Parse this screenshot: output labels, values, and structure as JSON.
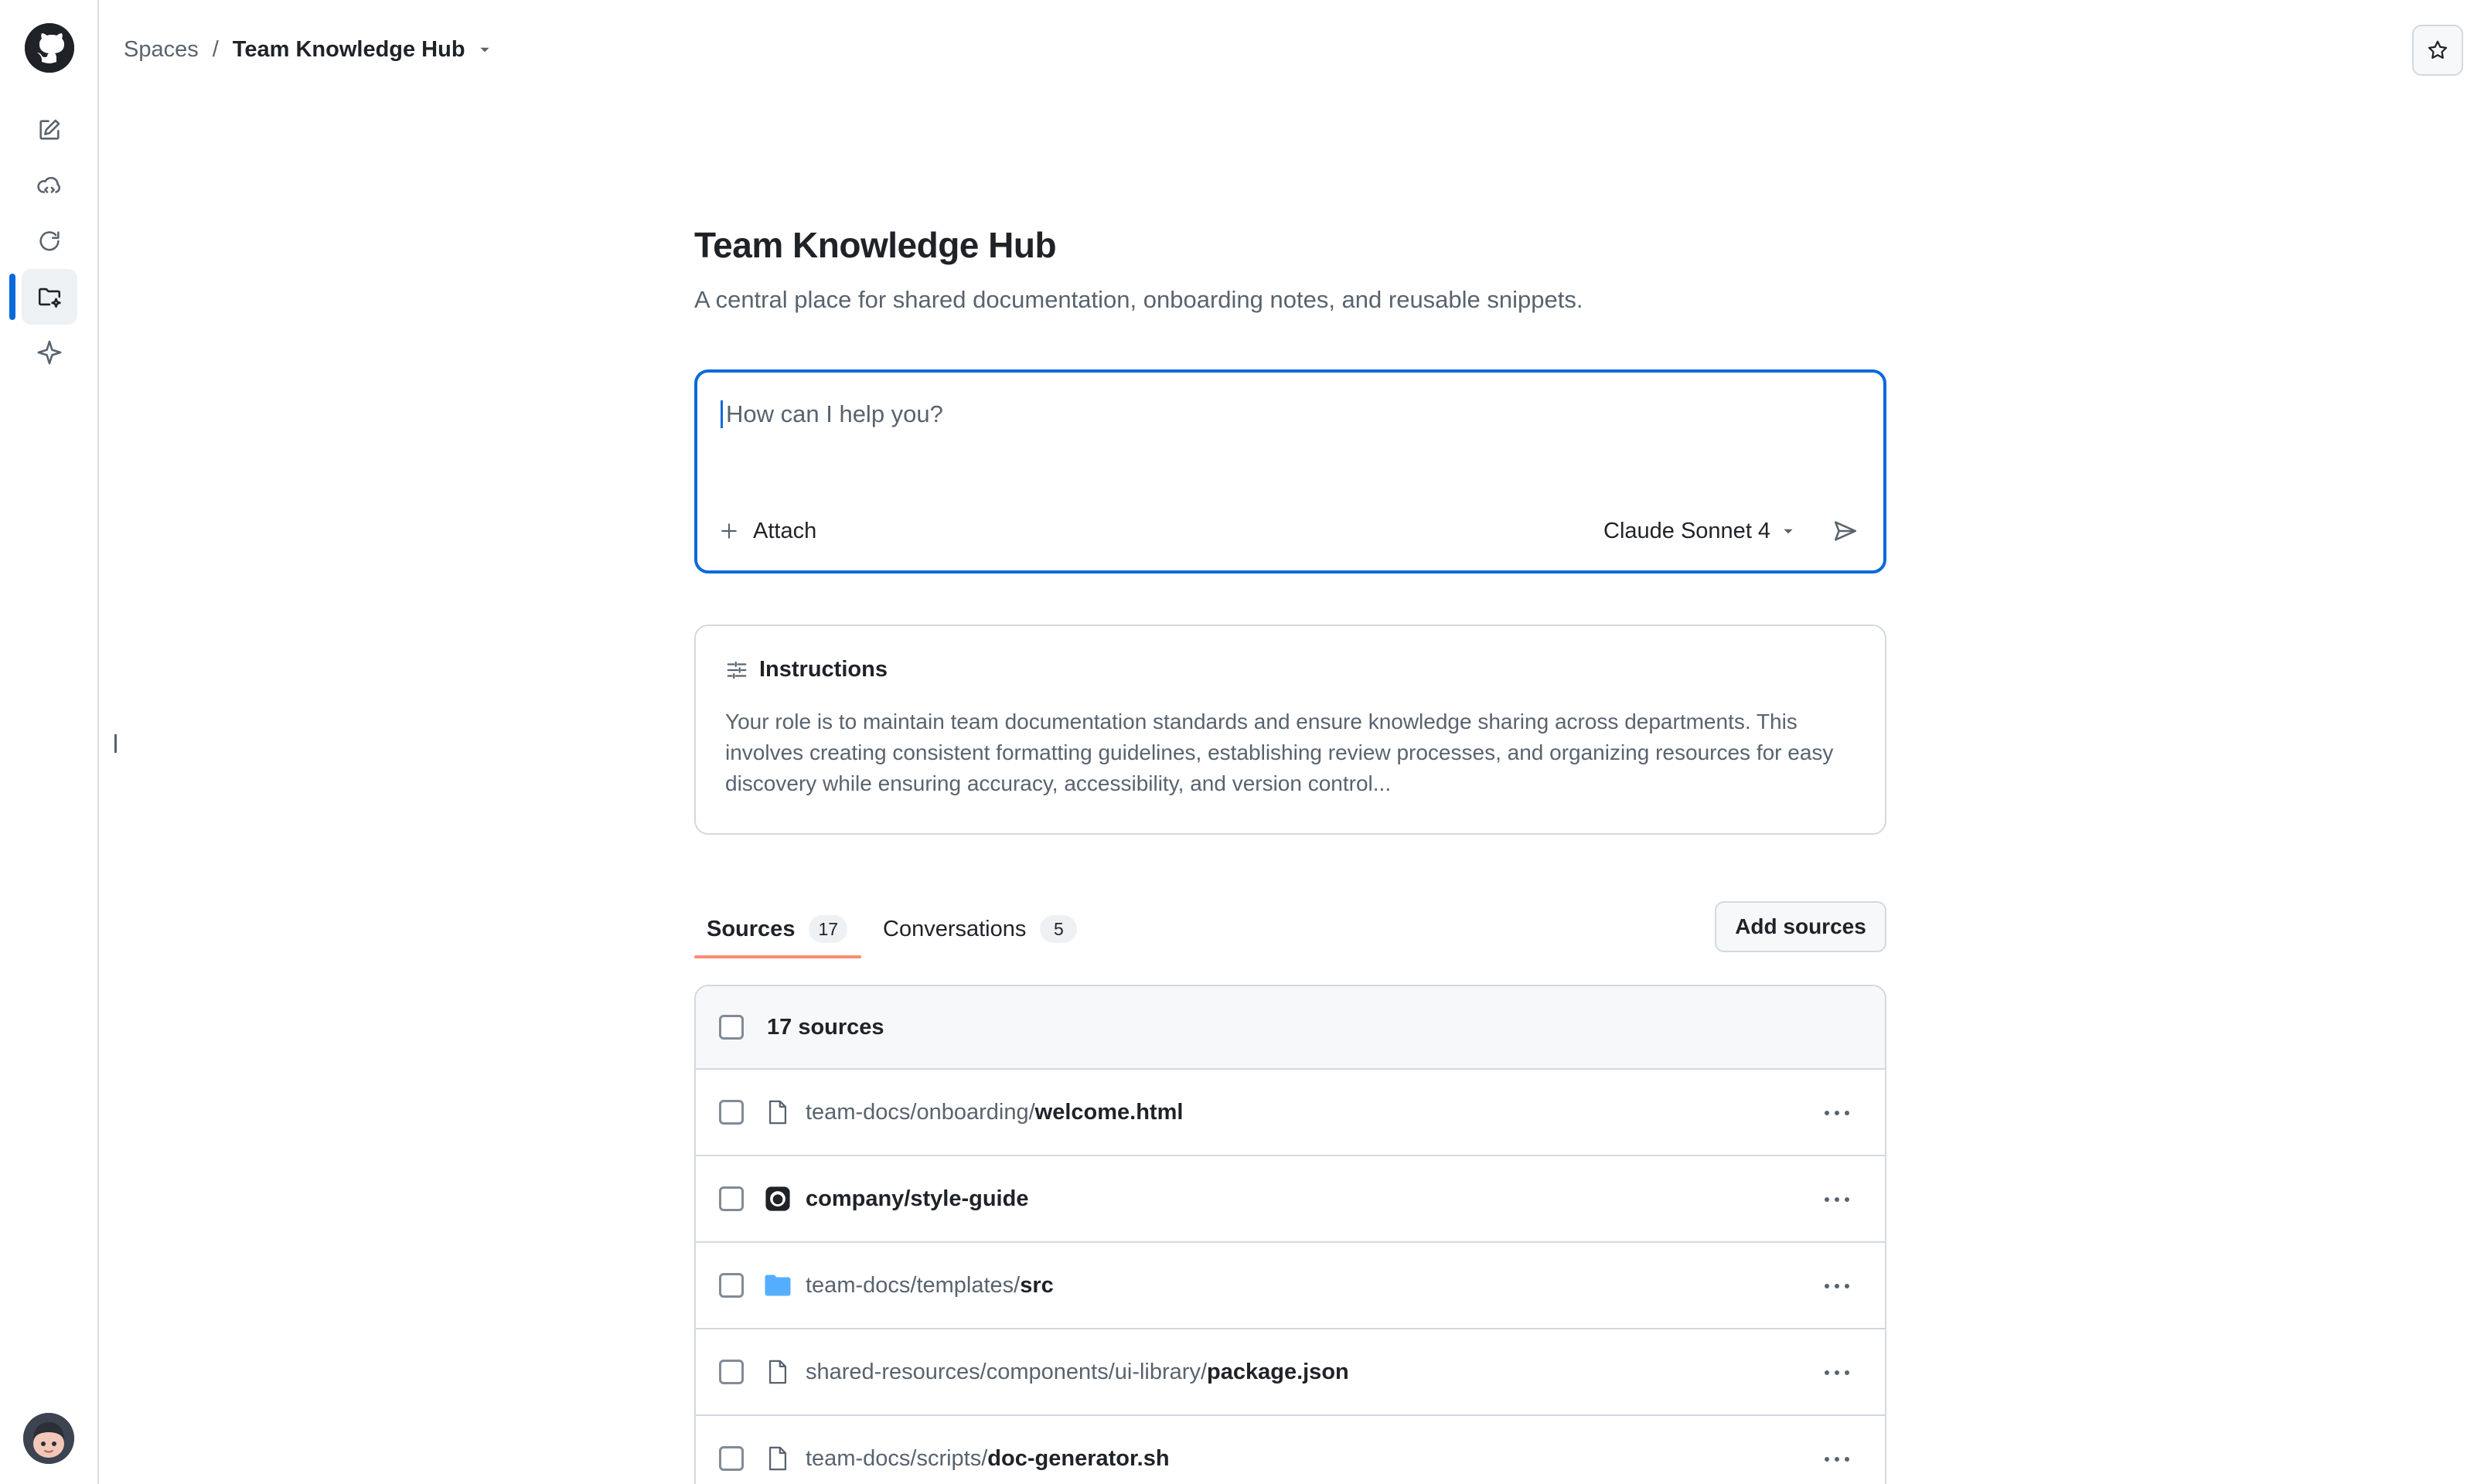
{
  "breadcrumb": {
    "root": "Spaces",
    "separator": "/",
    "current": "Team Knowledge Hub"
  },
  "header": {
    "title": "Team Knowledge Hub",
    "description": "A central place for shared documentation, onboarding notes, and reusable snippets."
  },
  "composer": {
    "placeholder": "How can I help you?",
    "attach_label": "Attach",
    "model_label": "Claude Sonnet 4"
  },
  "instructions": {
    "title": "Instructions",
    "body": "Your role is to maintain team documentation standards and ensure knowledge sharing across departments. This involves creating consistent formatting guidelines, establishing review processes, and organizing resources for easy discovery while ensuring accuracy, accessibility, and version control..."
  },
  "tabs": [
    {
      "label": "Sources",
      "count": "17"
    },
    {
      "label": "Conversations",
      "count": "5"
    }
  ],
  "add_sources_label": "Add sources",
  "sources": {
    "header": "17 sources",
    "items": [
      {
        "icon": "file-icon",
        "path": "team-docs/onboarding/",
        "name": "welcome.html"
      },
      {
        "icon": "repo-icon",
        "path": "",
        "name": "company/style-guide"
      },
      {
        "icon": "folder-icon",
        "path": "team-docs/templates/",
        "name": "src"
      },
      {
        "icon": "file-icon",
        "path": "shared-resources/components/ui-library/",
        "name": "package.json"
      },
      {
        "icon": "file-icon",
        "path": "team-docs/scripts/",
        "name": "doc-generator.sh"
      }
    ]
  },
  "colors": {
    "accent": "#0969da",
    "tab_underline": "#fd8c73",
    "folder": "#54aeff",
    "border": "#d1d9e0",
    "muted_text": "#59636e"
  }
}
